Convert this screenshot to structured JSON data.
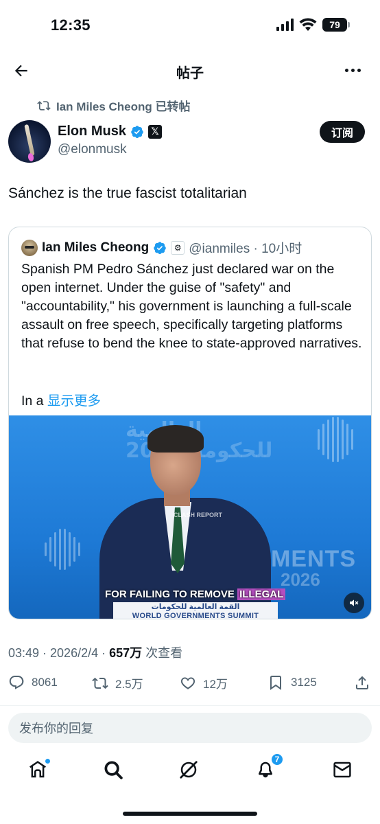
{
  "status_bar": {
    "time": "12:35",
    "battery": "79"
  },
  "header": {
    "title": "帖子"
  },
  "repost": {
    "text": "Ian Miles Cheong 已转帖"
  },
  "author": {
    "name": "Elon Musk",
    "handle": "@elonmusk",
    "x_badge": "𝕏"
  },
  "subscribe_label": "订阅",
  "tweet": {
    "text": "Sánchez is the true fascist totalitarian"
  },
  "quote": {
    "name": "Ian Miles Cheong",
    "handle_time": "@ianmiles · 10小时",
    "body": "Spanish PM Pedro Sánchez just declared war on the open internet. Under the guise of \"safety\" and \"accountability,\" his government is launching a full-scale assault on free speech, specifically targeting platforms that refuse to bend the knee to state-approved narratives.",
    "more_prefix": "In a ",
    "show_more": "显示更多",
    "video": {
      "caption_prefix": "FOR FAILING TO REMOVE ",
      "caption_highlight": "ILLEGAL",
      "podium_arabic": "القمة العالمية للحكومات",
      "podium_label": "WORLD GOVERNMENTS SUMMIT",
      "bg_ments": "MENTS",
      "bg_year": "2026",
      "bg_arabic_1": "العالمية",
      "bg_arabic_2": "للحكومات 202",
      "watermark": "CLASH REPORT"
    }
  },
  "meta": {
    "time_date": "03:49 · 2026/2/4 · ",
    "views": "657万",
    "views_label": " 次查看"
  },
  "actions": {
    "replies": "8061",
    "reposts": "2.5万",
    "likes": "12万",
    "bookmarks": "3125"
  },
  "reply": {
    "placeholder": "发布你的回复"
  },
  "nav": {
    "notifications_badge": "7"
  },
  "colors": {
    "accent": "#1d9bf0",
    "text": "#0f1419",
    "muted": "#536471"
  }
}
